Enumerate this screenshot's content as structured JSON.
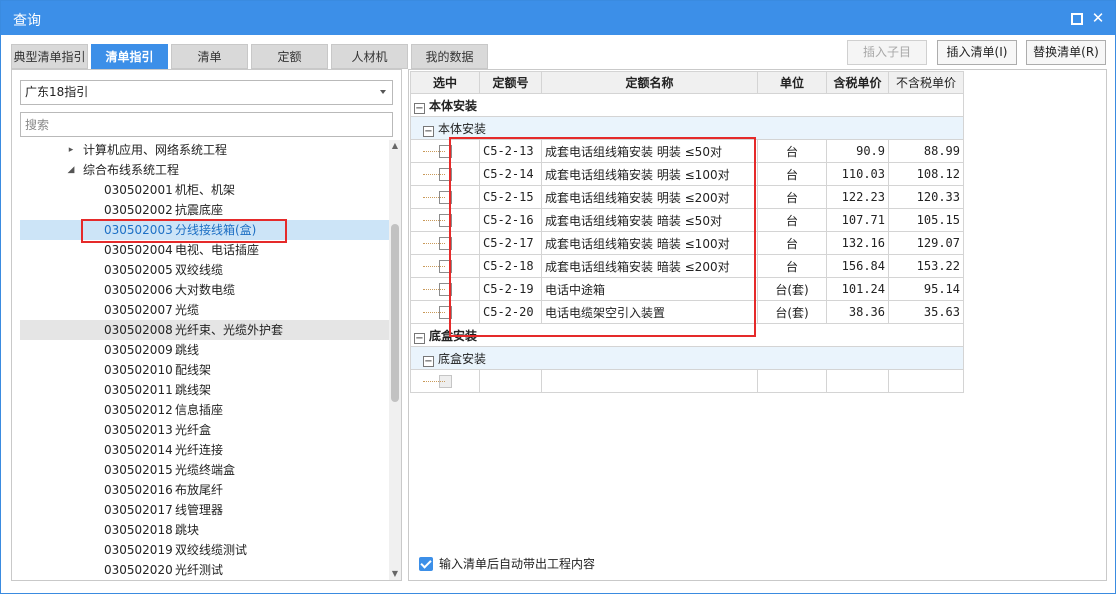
{
  "window": {
    "title": "查询"
  },
  "tabs": [
    {
      "label": "典型清单指引",
      "active": false
    },
    {
      "label": "清单指引",
      "active": true
    },
    {
      "label": "清单",
      "active": false
    },
    {
      "label": "定额",
      "active": false
    },
    {
      "label": "人材机",
      "active": false
    },
    {
      "label": "我的数据",
      "active": false
    }
  ],
  "actions": {
    "insert_child": "插入子目",
    "insert_list": "插入清单(I)",
    "replace_list": "替换清单(R)"
  },
  "left": {
    "select_value": "广东18指引",
    "search_placeholder": "搜索",
    "tree": [
      {
        "arrow": "▸",
        "code": "",
        "text": "计算机应用、网络系统工程",
        "state": ""
      },
      {
        "arrow": "◢",
        "code": "",
        "text": "综合布线系统工程",
        "state": ""
      },
      {
        "arrow": "",
        "code": "030502001",
        "text": "机柜、机架",
        "state": ""
      },
      {
        "arrow": "",
        "code": "030502002",
        "text": "抗震底座",
        "state": ""
      },
      {
        "arrow": "",
        "code": "030502003",
        "text": "分线接线箱(盒)",
        "state": "selected"
      },
      {
        "arrow": "",
        "code": "030502004",
        "text": "电视、电话插座",
        "state": ""
      },
      {
        "arrow": "",
        "code": "030502005",
        "text": "双绞线缆",
        "state": ""
      },
      {
        "arrow": "",
        "code": "030502006",
        "text": "大对数电缆",
        "state": ""
      },
      {
        "arrow": "",
        "code": "030502007",
        "text": "光缆",
        "state": ""
      },
      {
        "arrow": "",
        "code": "030502008",
        "text": "光纤束、光缆外护套",
        "state": "hover"
      },
      {
        "arrow": "",
        "code": "030502009",
        "text": "跳线",
        "state": ""
      },
      {
        "arrow": "",
        "code": "030502010",
        "text": "配线架",
        "state": ""
      },
      {
        "arrow": "",
        "code": "030502011",
        "text": "跳线架",
        "state": ""
      },
      {
        "arrow": "",
        "code": "030502012",
        "text": "信息插座",
        "state": ""
      },
      {
        "arrow": "",
        "code": "030502013",
        "text": "光纤盒",
        "state": ""
      },
      {
        "arrow": "",
        "code": "030502014",
        "text": "光纤连接",
        "state": ""
      },
      {
        "arrow": "",
        "code": "030502015",
        "text": "光缆终端盒",
        "state": ""
      },
      {
        "arrow": "",
        "code": "030502016",
        "text": "布放尾纤",
        "state": ""
      },
      {
        "arrow": "",
        "code": "030502017",
        "text": "线管理器",
        "state": ""
      },
      {
        "arrow": "",
        "code": "030502018",
        "text": "跳块",
        "state": ""
      },
      {
        "arrow": "",
        "code": "030502019",
        "text": "双绞线缆测试",
        "state": ""
      },
      {
        "arrow": "",
        "code": "030502020",
        "text": "光纤测试",
        "state": ""
      }
    ]
  },
  "grid": {
    "headers": [
      "选中",
      "定额号",
      "定额名称",
      "单位",
      "含税单价",
      "不含税单价"
    ],
    "group1a": "本体安装",
    "group2a": "本体安装",
    "rows": [
      {
        "code": "C5-2-13",
        "name": "成套电话组线箱安装 明装 ≤50对",
        "unit": "台",
        "tax": "90.9",
        "notax": "88.99"
      },
      {
        "code": "C5-2-14",
        "name": "成套电话组线箱安装 明装 ≤100对",
        "unit": "台",
        "tax": "110.03",
        "notax": "108.12"
      },
      {
        "code": "C5-2-15",
        "name": "成套电话组线箱安装 明装 ≤200对",
        "unit": "台",
        "tax": "122.23",
        "notax": "120.33"
      },
      {
        "code": "C5-2-16",
        "name": "成套电话组线箱安装 暗装 ≤50对",
        "unit": "台",
        "tax": "107.71",
        "notax": "105.15"
      },
      {
        "code": "C5-2-17",
        "name": "成套电话组线箱安装 暗装 ≤100对",
        "unit": "台",
        "tax": "132.16",
        "notax": "129.07"
      },
      {
        "code": "C5-2-18",
        "name": "成套电话组线箱安装 暗装 ≤200对",
        "unit": "台",
        "tax": "156.84",
        "notax": "153.22"
      },
      {
        "code": "C5-2-19",
        "name": "电话中途箱",
        "unit": "台(套)",
        "tax": "101.24",
        "notax": "95.14"
      },
      {
        "code": "C5-2-20",
        "name": "电话电缆架空引入装置",
        "unit": "台(套)",
        "tax": "38.36",
        "notax": "35.63"
      }
    ],
    "group1b": "底盒安装",
    "group2b": "底盒安装"
  },
  "footer": {
    "auto_label": "输入清单后自动带出工程内容"
  },
  "colors": {
    "accent": "#3c8fe8",
    "highlight": "#e52a2a"
  }
}
